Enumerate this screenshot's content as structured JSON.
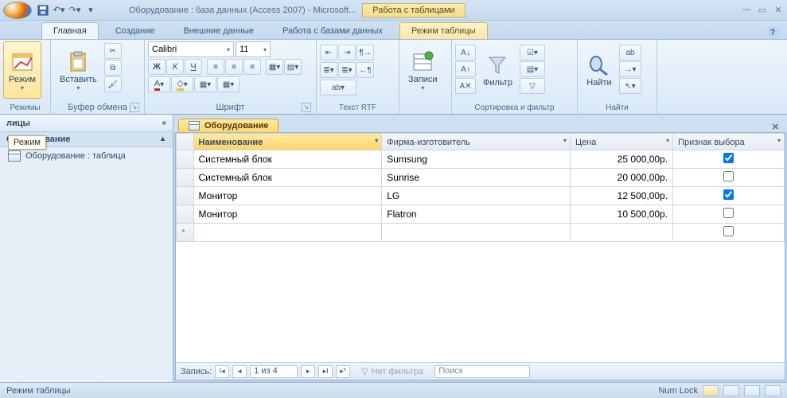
{
  "title": "Оборудование : база данных (Access 2007) - Microsoft...",
  "context_tab_title": "Работа с таблицами",
  "tabs": {
    "home": "Главная",
    "create": "Создание",
    "external": "Внешние данные",
    "dbtools": "Работа с базами данных",
    "table_mode": "Режим таблицы"
  },
  "ribbon": {
    "views_group": "Режимы",
    "view_btn": "Режим",
    "clipboard_group": "Буфер обмена",
    "paste_btn": "Вставить",
    "font_group": "Шрифт",
    "font_name": "Calibri",
    "font_size": "11",
    "text_group": "Текст RTF",
    "records_group": "Записи",
    "records_btn": "Записи",
    "sortfilter_group": "Сортировка и фильтр",
    "filter_btn": "Фильтр",
    "find_group": "Найти",
    "find_btn": "Найти"
  },
  "mode_tooltip": "Режим",
  "nav": {
    "header": "лицы",
    "group": "Оборудование",
    "item": "Оборудование : таблица"
  },
  "doctab": "Оборудование",
  "columns": {
    "c1": "Наименование",
    "c2": "Фирма-изготовитель",
    "c3": "Цена",
    "c4": "Признак выбора"
  },
  "rows": [
    {
      "name": "Системный блок",
      "firm": "Sumsung",
      "price": "25 000,00р.",
      "sel": true
    },
    {
      "name": "Системный блок",
      "firm": "Sunrise",
      "price": "20 000,00р.",
      "sel": false
    },
    {
      "name": "Монитор",
      "firm": "LG",
      "price": "12 500,00р.",
      "sel": true
    },
    {
      "name": "Монитор",
      "firm": "Flatron",
      "price": "10 500,00р.",
      "sel": false
    }
  ],
  "recnav": {
    "label": "Запись:",
    "pos": "1 из 4",
    "nofilter": "Нет фильтра",
    "search": "Поиск"
  },
  "status": {
    "left": "Режим таблицы",
    "numlock": "Num Lock"
  }
}
